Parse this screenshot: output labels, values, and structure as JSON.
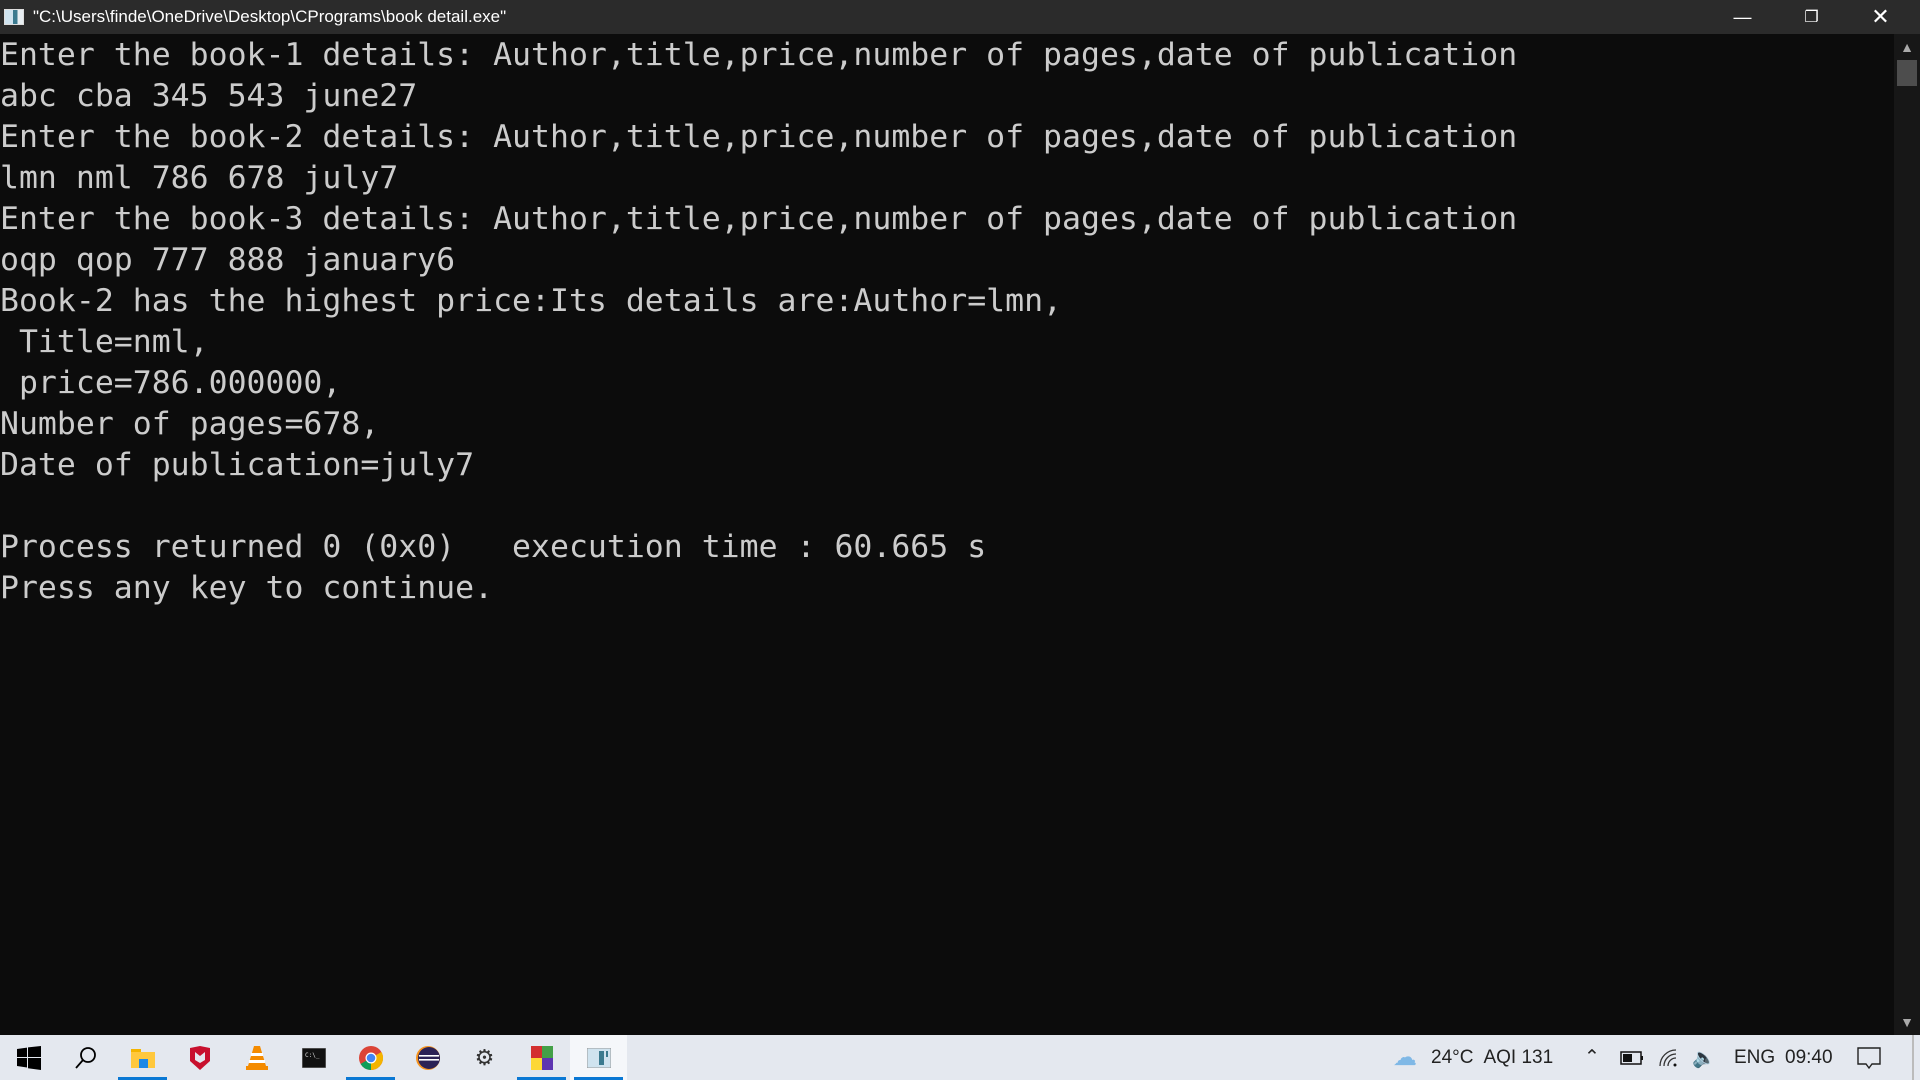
{
  "window": {
    "title": "\"C:\\Users\\finde\\OneDrive\\Desktop\\CPrograms\\book detail.exe\""
  },
  "console": {
    "lines": [
      "Enter the book-1 details: Author,title,price,number of pages,date of publication",
      "abc cba 345 543 june27",
      "Enter the book-2 details: Author,title,price,number of pages,date of publication",
      "lmn nml 786 678 july7",
      "Enter the book-3 details: Author,title,price,number of pages,date of publication",
      "oqp qop 777 888 january6",
      "Book-2 has the highest price:Its details are:Author=lmn,",
      " Title=nml,",
      " price=786.000000,",
      "Number of pages=678,",
      "Date of publication=july7",
      "",
      "Process returned 0 (0x0)   execution time : 60.665 s",
      "Press any key to continue."
    ]
  },
  "taskbar": {
    "apps": [
      {
        "name": "start",
        "icon": "windows-logo-icon"
      },
      {
        "name": "search",
        "icon": "search-icon"
      },
      {
        "name": "file-explorer",
        "icon": "folder-icon",
        "active": true
      },
      {
        "name": "mcafee",
        "icon": "mcafee-shield-icon"
      },
      {
        "name": "vlc",
        "icon": "vlc-cone-icon"
      },
      {
        "name": "command-prompt",
        "icon": "terminal-icon"
      },
      {
        "name": "chrome",
        "icon": "chrome-icon",
        "active": true
      },
      {
        "name": "eclipse",
        "icon": "eclipse-icon"
      },
      {
        "name": "settings",
        "icon": "gear-icon"
      },
      {
        "name": "codeblocks",
        "icon": "codeblocks-icon",
        "active": true
      },
      {
        "name": "console-window",
        "icon": "console-window-icon",
        "active": true,
        "current": true
      }
    ],
    "weather": {
      "temp": "24°C",
      "aqi": "AQI 131"
    },
    "language": "ENG",
    "time": "09:40"
  }
}
